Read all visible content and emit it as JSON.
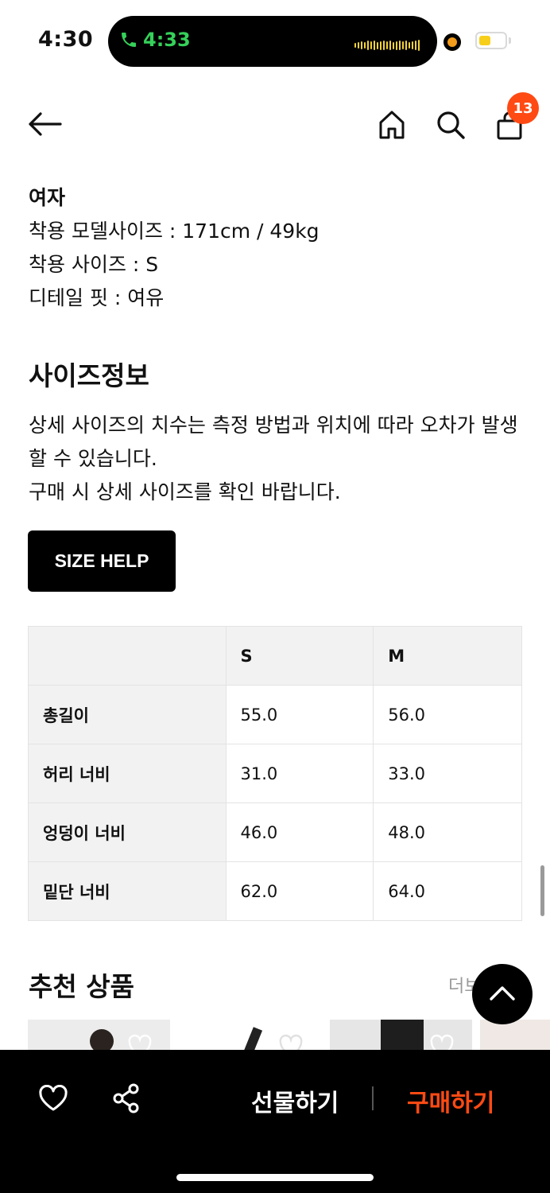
{
  "status_bar": {
    "time": "4:30",
    "call_time": "4:33"
  },
  "header": {
    "cart_count": "13"
  },
  "model_info": {
    "gender": "여자",
    "model_size": "착용 모델사이즈 : 171cm / 49kg",
    "worn_size": "착용 사이즈 : S",
    "fit": "디테일 핏 : 여유"
  },
  "size_info": {
    "title": "사이즈정보",
    "notice_line1": "상세 사이즈의 치수는 측정 방법과 위치에 따라 오차가 발생할 수 있습니다.",
    "notice_line2": "구매 시 상세 사이즈를 확인 바랍니다.",
    "help_button": "SIZE HELP",
    "columns": [
      "",
      "S",
      "M"
    ],
    "rows": [
      [
        "총길이",
        "55.0",
        "56.0"
      ],
      [
        "허리 너비",
        "31.0",
        "33.0"
      ],
      [
        "엉덩이 너비",
        "46.0",
        "48.0"
      ],
      [
        "밑단 너비",
        "62.0",
        "64.0"
      ]
    ]
  },
  "recommend": {
    "title": "추천 상품",
    "more": "더보"
  },
  "bottom_bar": {
    "gift": "선물하기",
    "buy": "구매하기"
  },
  "colors": {
    "accent": "#ff4a14",
    "call_green": "#35d15a",
    "black": "#000000"
  }
}
